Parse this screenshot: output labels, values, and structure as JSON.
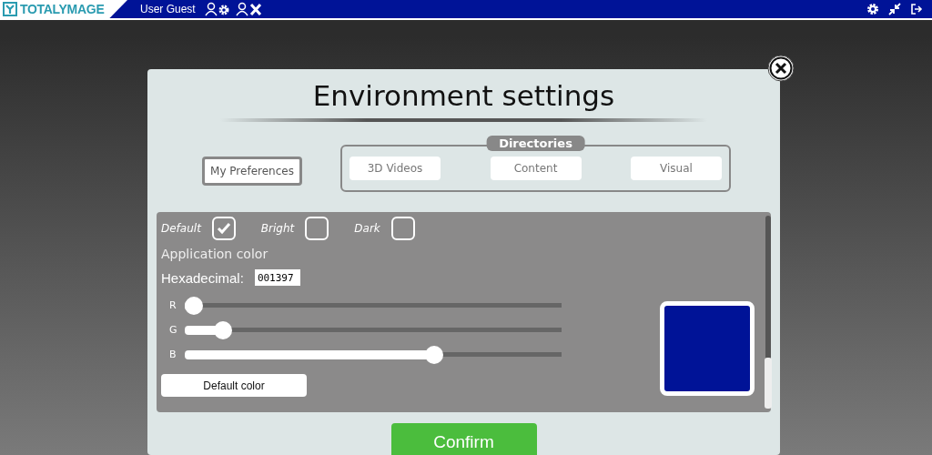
{
  "top_bar": {
    "logo": "TOTALYMAGE",
    "user": "User Guest"
  },
  "dialog": {
    "title": "Environment settings",
    "preferences_tab": {
      "label": "My Preferences",
      "selected": true
    },
    "directories": {
      "title": "Directories",
      "tabs": [
        {
          "label": "3D Videos",
          "selected": false
        },
        {
          "label": "Content",
          "selected": false
        },
        {
          "label": "Visual",
          "selected": false
        }
      ]
    },
    "themes": [
      {
        "label": "Default",
        "checked": true
      },
      {
        "label": "Bright",
        "checked": false
      },
      {
        "label": "Dark",
        "checked": false
      }
    ],
    "application_color_label": "Application color",
    "hexadecimal": {
      "label": "Hexadecimal:",
      "value": "001397"
    },
    "sliders": [
      {
        "label": "R",
        "level": 0
      },
      {
        "label": "G",
        "level": 0.08
      },
      {
        "label": "B",
        "level": 0.67
      }
    ],
    "swatch": {
      "color": "#001397"
    },
    "default_color_button": "Default color",
    "confirm_button": "Confirm"
  }
}
